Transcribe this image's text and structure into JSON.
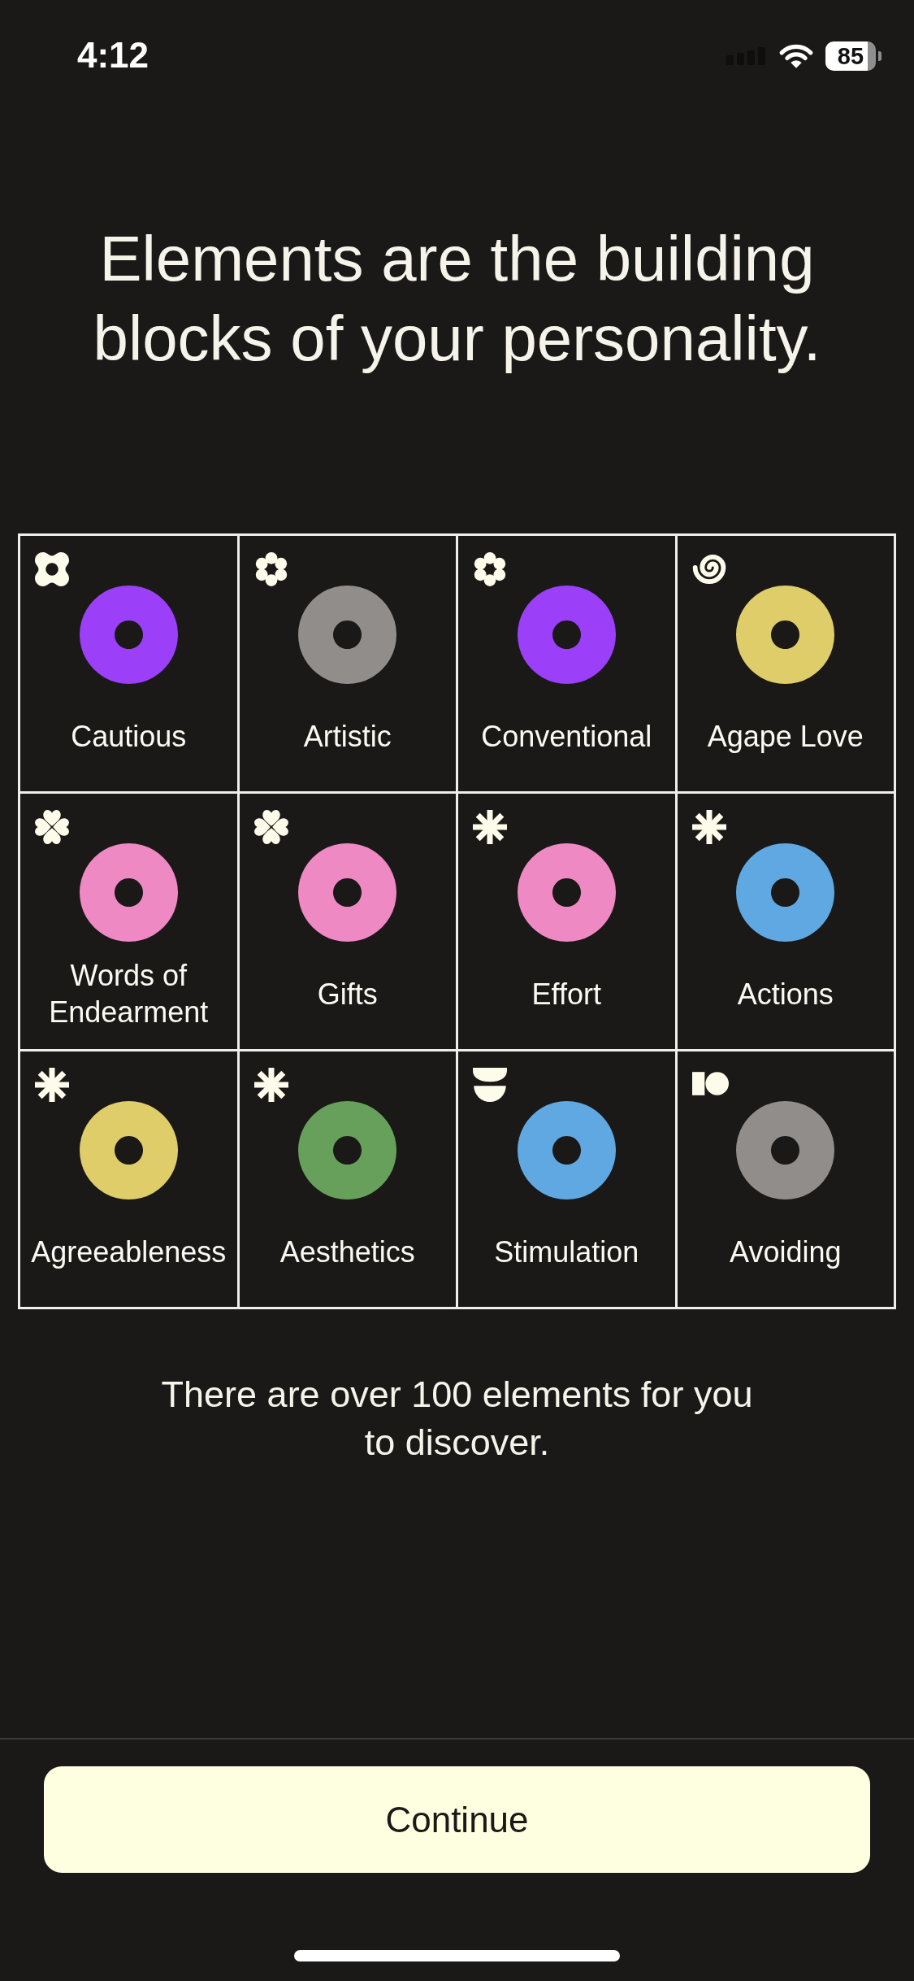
{
  "status_bar": {
    "time": "4:12",
    "battery": "85"
  },
  "title": "Elements are the building blocks of your personality.",
  "elements": [
    {
      "label": "Cautious",
      "kind": "cross",
      "color": "#9b3ff9"
    },
    {
      "label": "Artistic",
      "kind": "flower",
      "color": "#908d8b"
    },
    {
      "label": "Conventional",
      "kind": "flower",
      "color": "#9b3ff9"
    },
    {
      "label": "Agape Love",
      "kind": "spiral",
      "color": "#dfcd69"
    },
    {
      "label": "Words of Endearment",
      "kind": "clover",
      "color": "#ee89c3"
    },
    {
      "label": "Gifts",
      "kind": "clover",
      "color": "#ee89c3"
    },
    {
      "label": "Effort",
      "kind": "asterisk",
      "color": "#ee89c3"
    },
    {
      "label": "Actions",
      "kind": "asterisk",
      "color": "#5fa8e2"
    },
    {
      "label": "Agreeableness",
      "kind": "asterisk",
      "color": "#dfcd69"
    },
    {
      "label": "Aesthetics",
      "kind": "asterisk",
      "color": "#67a05b"
    },
    {
      "label": "Stimulation",
      "kind": "halves",
      "color": "#5fa8e2"
    },
    {
      "label": "Avoiding",
      "kind": "blocks",
      "color": "#908d8b"
    }
  ],
  "footnote": "There are over 100 elements for you to discover.",
  "continue_button": "Continue"
}
